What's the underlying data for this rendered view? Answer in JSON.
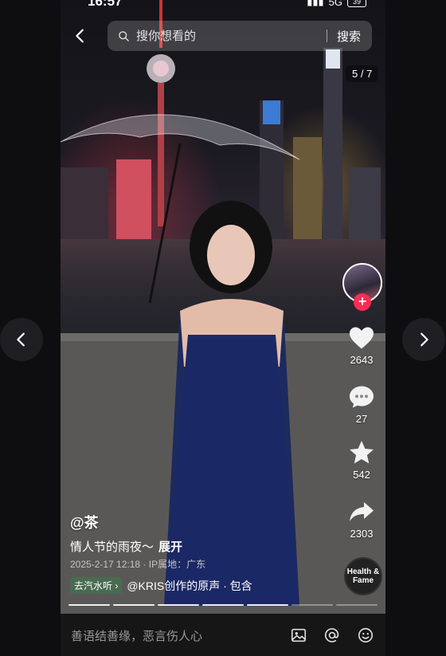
{
  "status_bar": {
    "time": "16:57",
    "network": "5G",
    "battery": "39"
  },
  "search": {
    "placeholder": "搜你想看的",
    "button_label": "搜索"
  },
  "page_counter": "5 / 7",
  "actions": {
    "likes": "2643",
    "comments": "27",
    "favorites": "542",
    "shares": "2303"
  },
  "post": {
    "author": "@茶",
    "caption": "情人节的雨夜～",
    "expand_label": "展开",
    "meta": "2025-2-17 12:18 · IP属地：广东",
    "music_tag": "去汽水听 ›",
    "music_title": "@KRIS创作的原声 · 包含"
  },
  "music_disc_text": "Health & Fame",
  "progress": {
    "segments": 7,
    "current": 5
  },
  "comment_bar": {
    "placeholder": "善语结善缘，恶言伤人心"
  },
  "colors": {
    "accent": "#fe2c55",
    "background": "#0e0e10"
  }
}
